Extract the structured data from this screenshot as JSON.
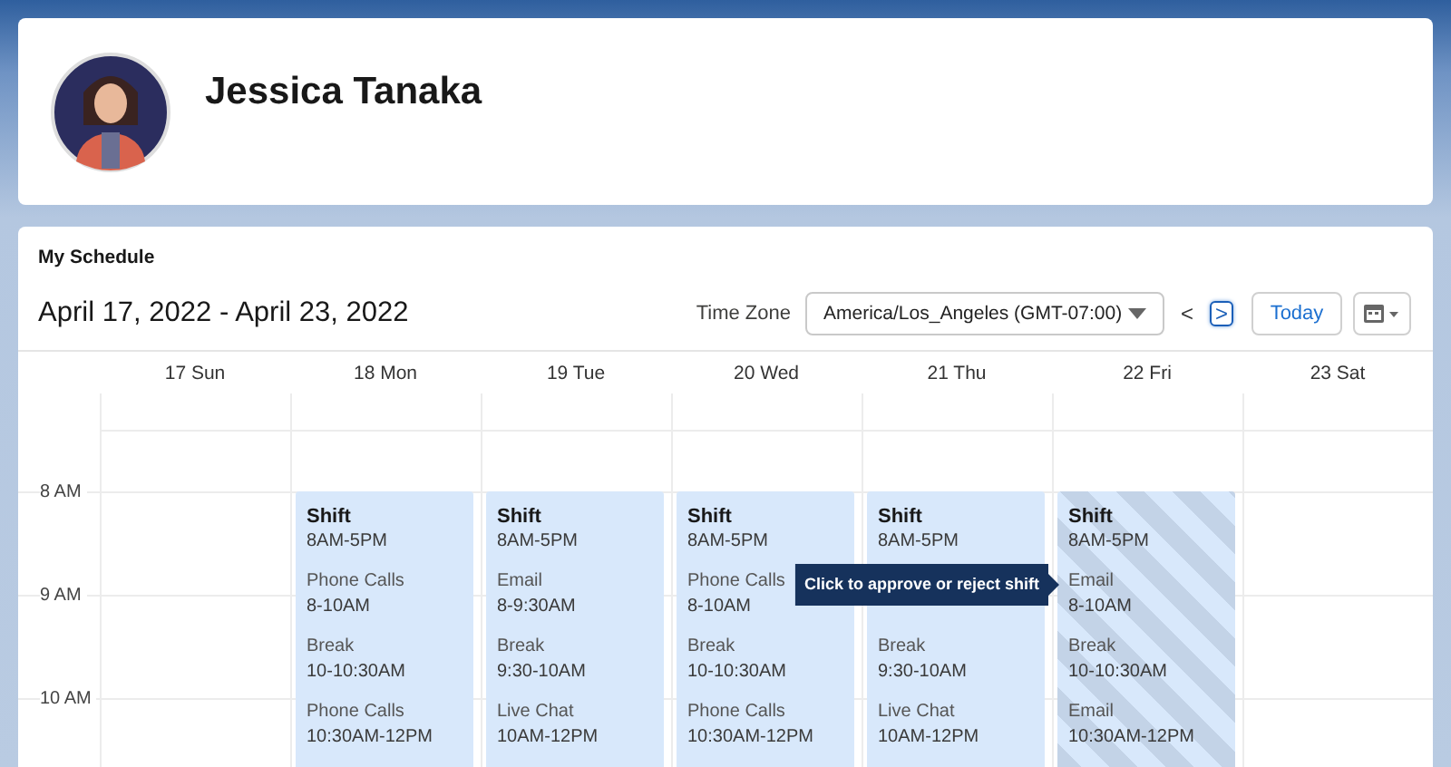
{
  "profile": {
    "name": "Jessica Tanaka"
  },
  "schedule": {
    "title": "My Schedule",
    "range": "April 17, 2022 - April 23, 2022",
    "timezone_label": "Time Zone",
    "timezone": "America/Los_Angeles (GMT-07:00)",
    "prev": {
      "label": "<",
      "focused": false
    },
    "next": {
      "label": ">",
      "focused": true
    },
    "today": "Today"
  },
  "hours": [
    "8 AM",
    "9 AM",
    "10 AM"
  ],
  "days": [
    {
      "label": "17 Sun"
    },
    {
      "label": "18 Mon",
      "shift": {
        "title": "Shift",
        "time": "8AM-5PM",
        "pending": false,
        "activities": [
          {
            "kind": "activity",
            "name": "Phone Calls",
            "time": "8-10AM"
          },
          {
            "kind": "activity",
            "name": "Break",
            "time": "10-10:30AM"
          },
          {
            "kind": "activity",
            "name": "Phone Calls",
            "time": "10:30AM-12PM"
          }
        ]
      }
    },
    {
      "label": "19 Tue",
      "shift": {
        "title": "Shift",
        "time": "8AM-5PM",
        "pending": false,
        "activities": [
          {
            "kind": "activity",
            "name": "Email",
            "time": "8-9:30AM"
          },
          {
            "kind": "activity",
            "name": "Break",
            "time": "9:30-10AM"
          },
          {
            "kind": "activity",
            "name": "Live Chat",
            "time": "10AM-12PM"
          }
        ]
      }
    },
    {
      "label": "20 Wed",
      "shift": {
        "title": "Shift",
        "time": "8AM-5PM",
        "pending": false,
        "activities": [
          {
            "kind": "activity",
            "name": "Phone Calls",
            "time": "8-10AM"
          },
          {
            "kind": "activity",
            "name": "Break",
            "time": "10-10:30AM"
          },
          {
            "kind": "activity",
            "name": "Phone Calls",
            "time": "10:30AM-12PM"
          }
        ]
      }
    },
    {
      "label": "21 Thu",
      "shift": {
        "title": "Shift",
        "time": "8AM-5PM",
        "pending": false,
        "activities": [
          {
            "kind": "covered"
          },
          {
            "kind": "activity",
            "name": "Break",
            "time": "9:30-10AM"
          },
          {
            "kind": "activity",
            "name": "Live Chat",
            "time": "10AM-12PM"
          }
        ]
      }
    },
    {
      "label": "22 Fri",
      "shift": {
        "title": "Shift",
        "time": "8AM-5PM",
        "pending": true,
        "activities": [
          {
            "kind": "activity",
            "name": "Email",
            "time": "8-10AM"
          },
          {
            "kind": "activity",
            "name": "Break",
            "time": "10-10:30AM"
          },
          {
            "kind": "activity",
            "name": "Email",
            "time": "10:30AM-12PM"
          }
        ]
      }
    },
    {
      "label": "23 Sat"
    }
  ],
  "tooltip": {
    "text": "Click to approve or reject shift"
  }
}
